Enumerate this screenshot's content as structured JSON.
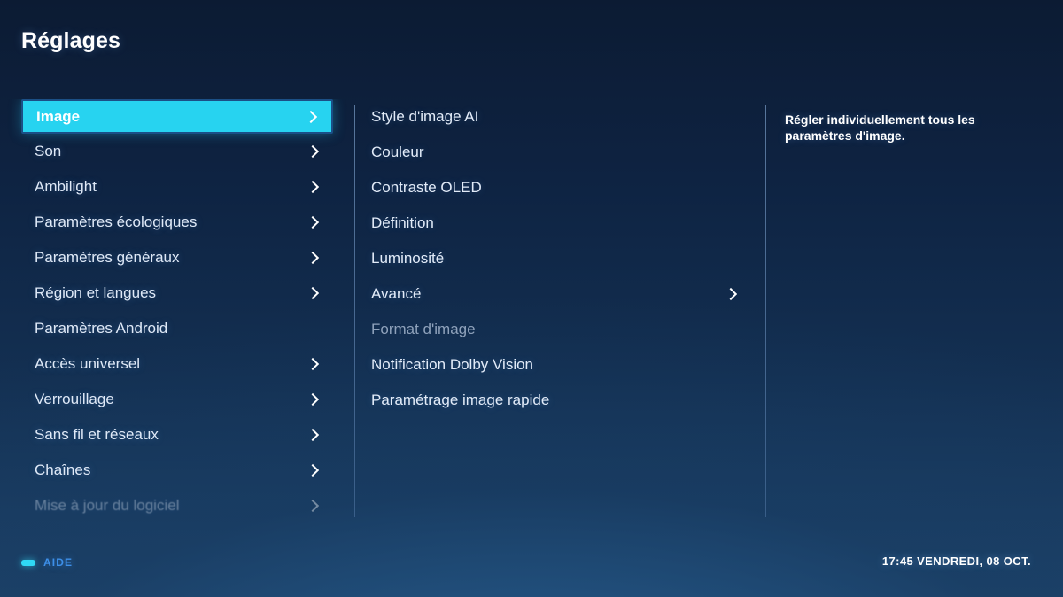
{
  "header": {
    "title": "Réglages"
  },
  "colors": {
    "highlight": "#27d3f0",
    "highlight_border": "#1b4f86",
    "background_top": "#0c1b33",
    "background_bottom": "#1d4167",
    "text_primary": "#dfe9f7",
    "text_disabled": "#8fa2bb",
    "help_label": "#3d8fe8",
    "help_key": "#2fd8f4"
  },
  "sidebar": {
    "items": [
      {
        "label": "Image",
        "chevron": true,
        "selected": true,
        "disabled": false,
        "faded": false
      },
      {
        "label": "Son",
        "chevron": true,
        "selected": false,
        "disabled": false,
        "faded": false
      },
      {
        "label": "Ambilight",
        "chevron": true,
        "selected": false,
        "disabled": false,
        "faded": false
      },
      {
        "label": "Paramètres écologiques",
        "chevron": true,
        "selected": false,
        "disabled": false,
        "faded": false
      },
      {
        "label": "Paramètres généraux",
        "chevron": true,
        "selected": false,
        "disabled": false,
        "faded": false
      },
      {
        "label": "Région et langues",
        "chevron": true,
        "selected": false,
        "disabled": false,
        "faded": false
      },
      {
        "label": "Paramètres Android",
        "chevron": false,
        "selected": false,
        "disabled": false,
        "faded": false
      },
      {
        "label": "Accès universel",
        "chevron": true,
        "selected": false,
        "disabled": false,
        "faded": false
      },
      {
        "label": "Verrouillage",
        "chevron": true,
        "selected": false,
        "disabled": false,
        "faded": false
      },
      {
        "label": "Sans fil et réseaux",
        "chevron": true,
        "selected": false,
        "disabled": false,
        "faded": false
      },
      {
        "label": "Chaînes",
        "chevron": true,
        "selected": false,
        "disabled": false,
        "faded": false
      },
      {
        "label": "Mise à jour du logiciel",
        "chevron": true,
        "selected": false,
        "disabled": false,
        "faded": true
      }
    ]
  },
  "submenu": {
    "items": [
      {
        "label": "Style d'image AI",
        "chevron": false,
        "disabled": false
      },
      {
        "label": "Couleur",
        "chevron": false,
        "disabled": false
      },
      {
        "label": "Contraste OLED",
        "chevron": false,
        "disabled": false
      },
      {
        "label": "Définition",
        "chevron": false,
        "disabled": false
      },
      {
        "label": "Luminosité",
        "chevron": false,
        "disabled": false
      },
      {
        "label": "Avancé",
        "chevron": true,
        "disabled": false
      },
      {
        "label": "Format d'image",
        "chevron": false,
        "disabled": true
      },
      {
        "label": "Notification Dolby Vision",
        "chevron": false,
        "disabled": false
      },
      {
        "label": "Paramétrage image rapide",
        "chevron": false,
        "disabled": false
      }
    ]
  },
  "info_panel": {
    "description": "Régler individuellement tous les paramètres d'image."
  },
  "bottom_bar": {
    "help_label": "AIDE",
    "help_key_icon": "remote-key-icon",
    "clock": "17:45 VENDREDI, 08 OCT."
  }
}
